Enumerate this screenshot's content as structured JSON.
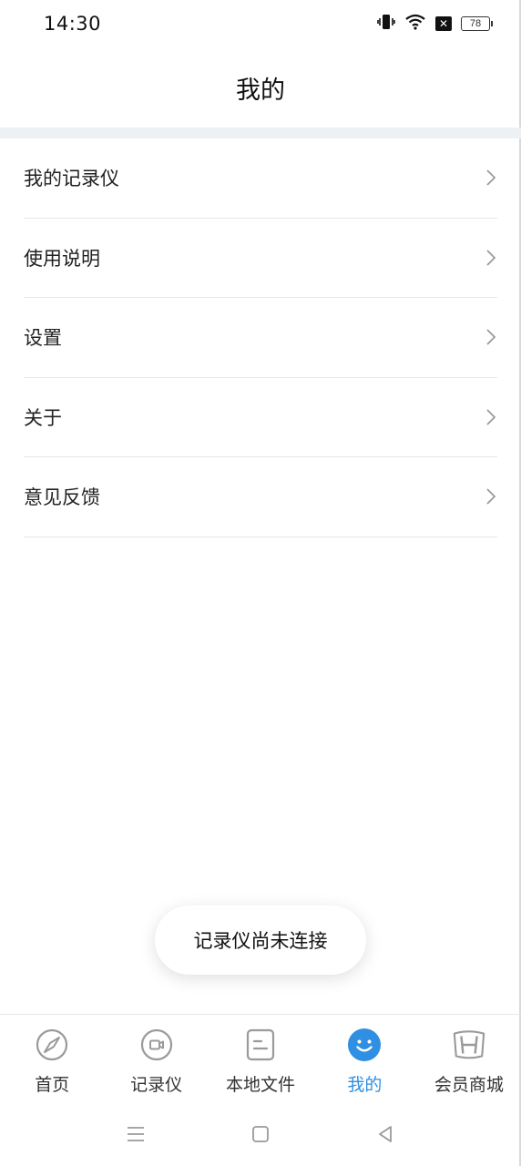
{
  "status_bar": {
    "time": "14:30",
    "battery": "78",
    "icons": [
      "vibrate-icon",
      "wifi-icon",
      "no-sim-icon",
      "battery-icon"
    ]
  },
  "header": {
    "title": "我的"
  },
  "menu": {
    "items": [
      {
        "label": "我的记录仪"
      },
      {
        "label": "使用说明"
      },
      {
        "label": "设置"
      },
      {
        "label": "关于"
      },
      {
        "label": "意见反馈"
      }
    ]
  },
  "toast": {
    "text": "记录仪尚未连接"
  },
  "tabbar": {
    "active_color": "#2f8fe3",
    "items": [
      {
        "label": "首页",
        "icon": "compass-icon"
      },
      {
        "label": "记录仪",
        "icon": "recorder-icon"
      },
      {
        "label": "本地文件",
        "icon": "document-icon"
      },
      {
        "label": "我的",
        "icon": "smiley-icon"
      },
      {
        "label": "会员商城",
        "icon": "honda-logo-icon"
      }
    ]
  },
  "navbar": {
    "icons": [
      "menu-nav-icon",
      "home-nav-icon",
      "back-nav-icon"
    ]
  }
}
